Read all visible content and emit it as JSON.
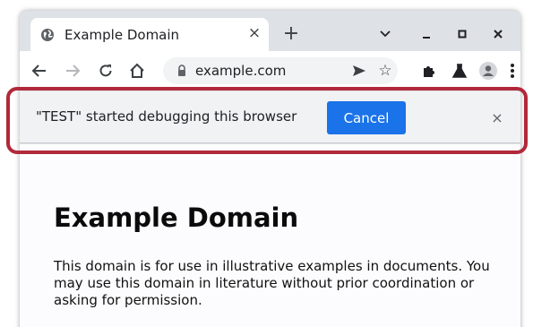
{
  "tab": {
    "title": "Example Domain",
    "close": "×"
  },
  "newtab": {
    "label": "+"
  },
  "omnibox": {
    "url": "example.com",
    "star": "☆"
  },
  "infobar": {
    "message": "\"TEST\" started debugging this browser",
    "cancel_label": "Cancel",
    "close": "×"
  },
  "page": {
    "heading": "Example Domain",
    "paragraph": "This domain is for use in illustrative examples in documents. You may use this domain in literature without prior coordination or asking for permission."
  },
  "colors": {
    "accent": "#1a73e8",
    "highlight": "#b1283a",
    "frame": "#dee1e6"
  }
}
